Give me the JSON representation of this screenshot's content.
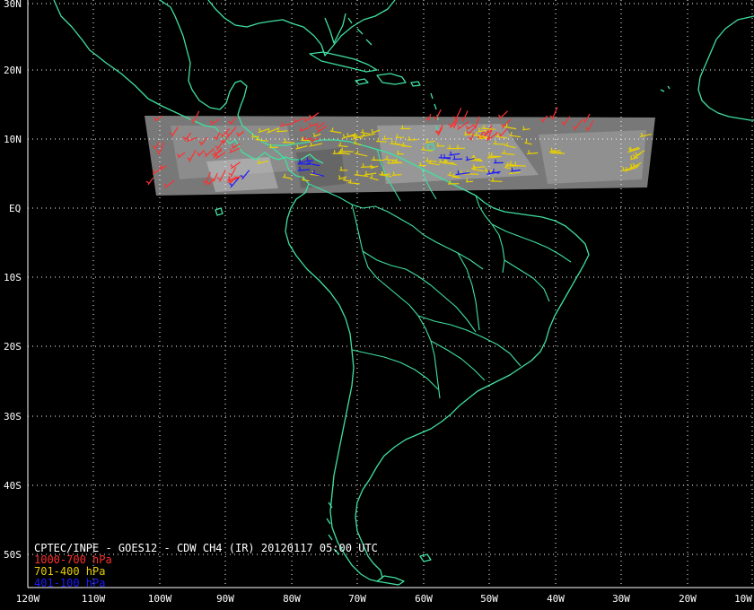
{
  "caption": {
    "title": "CPTEC/INPE - GOES12 - CDW CH4 (IR) 20120117 05:00 UTC",
    "legend": [
      {
        "label": "1000-700 hPa",
        "color": "#ff3030"
      },
      {
        "label": "701-400 hPa",
        "color": "#e8d000"
      },
      {
        "label": "401-100 hPa",
        "color": "#1a1aff"
      }
    ]
  },
  "axes": {
    "lat_labels": [
      "30N",
      "20N",
      "10N",
      "EQ",
      "10S",
      "20S",
      "30S",
      "40S",
      "50S"
    ],
    "lon_labels": [
      "120W",
      "110W",
      "100W",
      "90W",
      "80W",
      "70W",
      "60W",
      "50W",
      "40W",
      "30W",
      "20W",
      "10W"
    ]
  },
  "colors": {
    "background": "#000000",
    "coastline": "#40e0a0",
    "grid": "#ffffff",
    "imagery": "#8a8a8a"
  }
}
